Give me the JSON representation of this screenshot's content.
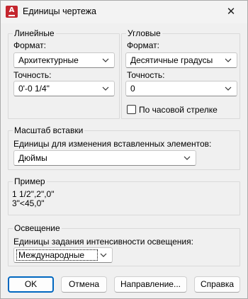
{
  "window": {
    "title": "Единицы чертежа",
    "close_glyph": "✕"
  },
  "linear": {
    "legend": "Линейные",
    "format_label": "Формат:",
    "format_value": "Архитектурные",
    "precision_label": "Точность:",
    "precision_value": "0'-0 1/4\""
  },
  "angular": {
    "legend": "Угловые",
    "format_label": "Формат:",
    "format_value": "Десятичные градусы",
    "precision_label": "Точность:",
    "precision_value": "0",
    "clockwise_label": "По часовой стрелке",
    "clockwise_checked": false
  },
  "insert_scale": {
    "legend": "Масштаб вставки",
    "units_label": "Единицы для изменения вставленных элементов:",
    "units_value": "Дюймы"
  },
  "sample": {
    "legend": "Пример",
    "line1": "1 1/2\",2\",0\"",
    "line2": "3\"<45,0\""
  },
  "lighting": {
    "legend": "Освещение",
    "units_label": "Единицы задания интенсивности освещения:",
    "units_value": "Международные"
  },
  "buttons": {
    "ok": "OK",
    "cancel": "Отмена",
    "direction": "Направление...",
    "help": "Справка"
  },
  "colors": {
    "accent": "#0067c0",
    "app_icon": "#c4262e",
    "background": "#f0f0f0"
  },
  "icons": {
    "app": "autocad-app-icon",
    "close": "close-icon",
    "dropdown": "chevron-down-icon"
  }
}
